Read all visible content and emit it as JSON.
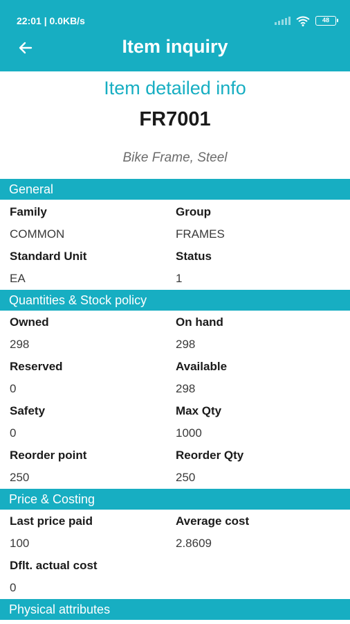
{
  "status_bar": {
    "time": "22:01 | 0.0KB/s",
    "battery": "48",
    "icons": [
      "signal-icon",
      "wifi-icon",
      "battery-icon"
    ]
  },
  "app_bar": {
    "title": "Item inquiry",
    "back_icon": "arrow-back-icon"
  },
  "item": {
    "heading": "Item detailed info",
    "code": "FR7001",
    "description": "Bike Frame, Steel"
  },
  "sections": {
    "general": {
      "title": "General",
      "family_label": "Family",
      "family_value": "COMMON",
      "group_label": "Group",
      "group_value": "FRAMES",
      "std_unit_label": "Standard Unit",
      "std_unit_value": "EA",
      "status_label": "Status",
      "status_value": "1"
    },
    "quantities": {
      "title": "Quantities & Stock policy",
      "owned_label": "Owned",
      "owned_value": "298",
      "on_hand_label": "On hand",
      "on_hand_value": "298",
      "reserved_label": "Reserved",
      "reserved_value": "0",
      "available_label": "Available",
      "available_value": "298",
      "safety_label": "Safety",
      "safety_value": "0",
      "max_qty_label": "Max Qty",
      "max_qty_value": "1000",
      "reorder_point_label": "Reorder point",
      "reorder_point_value": "250",
      "reorder_qty_label": "Reorder Qty",
      "reorder_qty_value": "250"
    },
    "price": {
      "title": "Price & Costing",
      "last_price_label": "Last price paid",
      "last_price_value": "100",
      "avg_cost_label": "Average cost",
      "avg_cost_value": "2.8609",
      "dflt_cost_label": "Dflt. actual cost",
      "dflt_cost_value": "0"
    },
    "physical": {
      "title": "Physical attributes"
    }
  },
  "colors": {
    "accent": "#17aec2",
    "text_dark": "#1a1a1a",
    "text_muted": "#6b6b6b"
  }
}
